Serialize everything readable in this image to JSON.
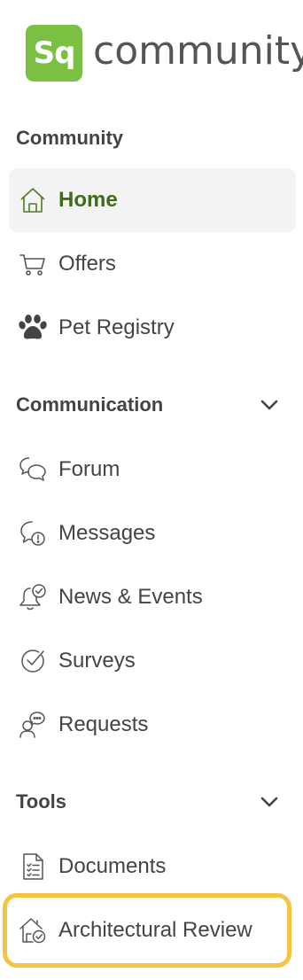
{
  "brand": {
    "logo_letters": "Sq",
    "name": "community",
    "logo_color": "#7ac143"
  },
  "sections": {
    "community": {
      "title": "Community",
      "items": [
        {
          "label": "Home",
          "icon": "home-icon",
          "active": true
        },
        {
          "label": "Offers",
          "icon": "cart-icon"
        },
        {
          "label": "Pet Registry",
          "icon": "paw-icon"
        }
      ]
    },
    "communication": {
      "title": "Communication",
      "chevron": "chevron-down-icon",
      "items": [
        {
          "label": "Forum",
          "icon": "forum-icon"
        },
        {
          "label": "Messages",
          "icon": "messages-icon"
        },
        {
          "label": "News & Events",
          "icon": "bell-icon"
        },
        {
          "label": "Surveys",
          "icon": "survey-check-icon"
        },
        {
          "label": "Requests",
          "icon": "request-person-icon"
        }
      ]
    },
    "tools": {
      "title": "Tools",
      "chevron": "chevron-down-icon",
      "items": [
        {
          "label": "Documents",
          "icon": "document-icon"
        },
        {
          "label": "Architectural Review",
          "icon": "house-check-icon",
          "highlighted": true
        }
      ]
    }
  },
  "colors": {
    "active_text": "#3e6b1c",
    "highlight_border": "#f4c443",
    "active_bg": "#f3f3f3"
  }
}
